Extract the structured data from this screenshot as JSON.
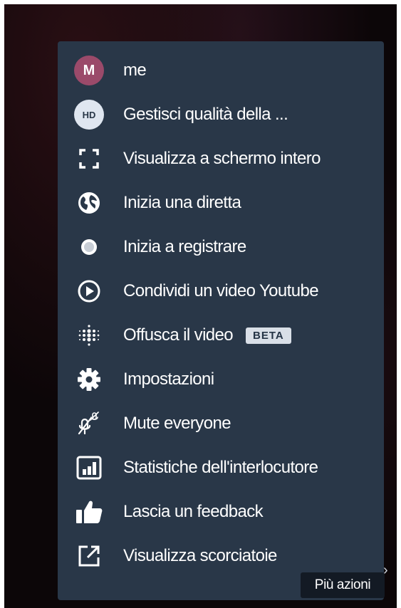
{
  "menu": {
    "items": [
      {
        "label": "me",
        "icon": "avatar-icon",
        "avatar_letter": "M"
      },
      {
        "label": "Gestisci qualità della ...",
        "icon": "hd-icon",
        "badge_text": "HD"
      },
      {
        "label": "Visualizza a schermo intero",
        "icon": "fullscreen-icon"
      },
      {
        "label": "Inizia una diretta",
        "icon": "globe-icon"
      },
      {
        "label": "Inizia a registrare",
        "icon": "record-icon"
      },
      {
        "label": "Condividi un video Youtube",
        "icon": "play-circle-icon"
      },
      {
        "label": "Offusca il video",
        "icon": "blur-dots-icon",
        "tag": "BETA"
      },
      {
        "label": "Impostazioni",
        "icon": "gear-icon"
      },
      {
        "label": "Mute everyone",
        "icon": "mic-muted-icon"
      },
      {
        "label": "Statistiche dell'interlocutore",
        "icon": "stats-icon"
      },
      {
        "label": "Lascia un feedback",
        "icon": "thumbs-up-icon"
      },
      {
        "label": "Visualizza scorciatoie",
        "icon": "external-link-icon"
      }
    ]
  },
  "tooltip": {
    "text": "Più azioni"
  },
  "colors": {
    "menu_bg": "#293748",
    "avatar_bg": "#9b4a6a",
    "tooltip_bg": "#131a24",
    "text": "#ffffff"
  }
}
